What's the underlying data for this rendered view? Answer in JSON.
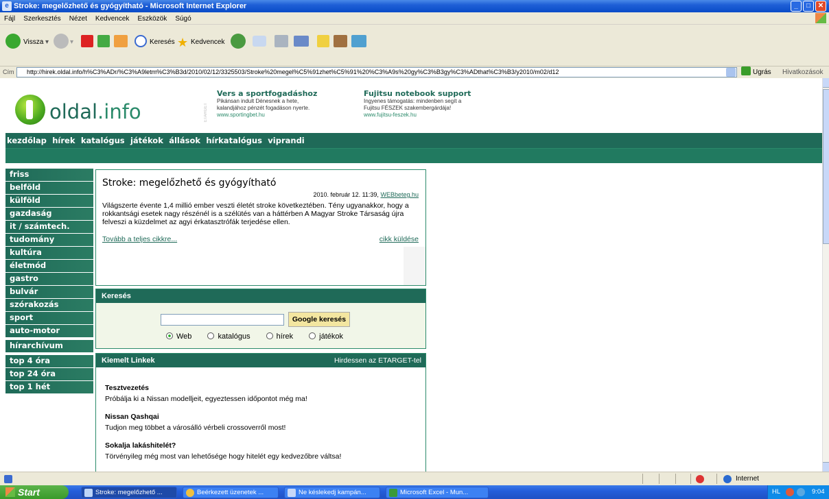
{
  "window": {
    "title": "Stroke: megelőzhető és gyógyítható - Microsoft Internet Explorer"
  },
  "menu": [
    "Fájl",
    "Szerkesztés",
    "Nézet",
    "Kedvencek",
    "Eszközök",
    "Súgó"
  ],
  "toolbar": {
    "back": "Vissza",
    "search": "Keresés",
    "favorites": "Kedvencek"
  },
  "address": {
    "label": "Cím",
    "url": "http://hirek.oldal.info/h%C3%ADr/%C3%A9letm%C3%B3d/2010/02/12/3325503/Stroke%20megel%C5%91zhet%C5%91%20%C3%A9s%20gy%C3%B3gy%C3%ADthat%C3%B3/y2010/m02/d12",
    "go": "Ugrás",
    "links": "Hivatkozások"
  },
  "site": {
    "logo_a": "oldal",
    "logo_b": ".info",
    "etarget": "ETARGET",
    "ads": [
      {
        "title": "Vers a sportfogadáshoz",
        "line1": "Pikánsan indult Dénesnek a hete,",
        "line2": "kalandjához pénzét fogadáson nyerte.",
        "url": "www.sportingbet.hu"
      },
      {
        "title": "Fujitsu notebook support",
        "line1": "Ingyenes támogatás: mindenben segít a",
        "line2": "Fujitsu FÉSZEK szakembergárdája!",
        "url": "www.fujitsu-feszek.hu"
      }
    ],
    "nav": [
      "kezdőlap",
      "hírek",
      "katalógus",
      "játékok",
      "állások",
      "hírkatalógus",
      "viprandi"
    ],
    "sidebar_main": [
      "friss",
      "belföld",
      "külföld",
      "gazdaság",
      "it / számtech.",
      "tudomány",
      "kultúra",
      "életmód",
      "gastro",
      "bulvár",
      "szórakozás",
      "sport",
      "auto-motor"
    ],
    "sidebar_archive": "hírarchívum",
    "sidebar_top": [
      "top 4 óra",
      "top 24 óra",
      "top 1 hét"
    ]
  },
  "article": {
    "title": "Stroke: megelőzhető és gyógyítható",
    "date": "2010. február 12. 11:39,",
    "source": "WEBbeteg.hu",
    "body": "Világszerte évente 1,4 millió ember veszti életét stroke következtében. Tény ugyanakkor, hogy a rokkantsági esetek nagy részénél is a szélütés van a háttérben A Magyar Stroke Társaság újra felveszi a küzdelmet az agyi érkatasztrófák terjedése ellen.",
    "more": "Tovább a teljes cikkre...",
    "send": "cikk küldése"
  },
  "search": {
    "title": "Keresés",
    "button": "Google keresés",
    "input_value": "",
    "options": [
      "Web",
      "katalógus",
      "hírek",
      "játékok"
    ],
    "selected": "Web"
  },
  "featured": {
    "title": "Kiemelt Linkek",
    "advertise": "Hirdessen az ETARGET-tel",
    "items": [
      {
        "title": "Tesztvezetés",
        "text": "Próbálja ki a Nissan modelljeit, egyeztessen időpontot még ma!"
      },
      {
        "title": "Nissan Qashqai",
        "text": "Tudjon meg többet a városálló vérbeli crossoverről most!"
      },
      {
        "title": "Sokalja lakáshitelét?",
        "text": "Törvényileg még most van lehetősége hogy hitelét egy kedvezőbre váltsa!"
      }
    ]
  },
  "status": {
    "zone": "Internet"
  },
  "taskbar": {
    "start": "Start",
    "tasks": [
      "Stroke: megelőzhető ...",
      "Beérkezett üzenetek ...",
      "Ne késlekedj kampán...",
      "Microsoft Excel - Mun..."
    ],
    "lang": "HL",
    "clock": "9:04"
  }
}
